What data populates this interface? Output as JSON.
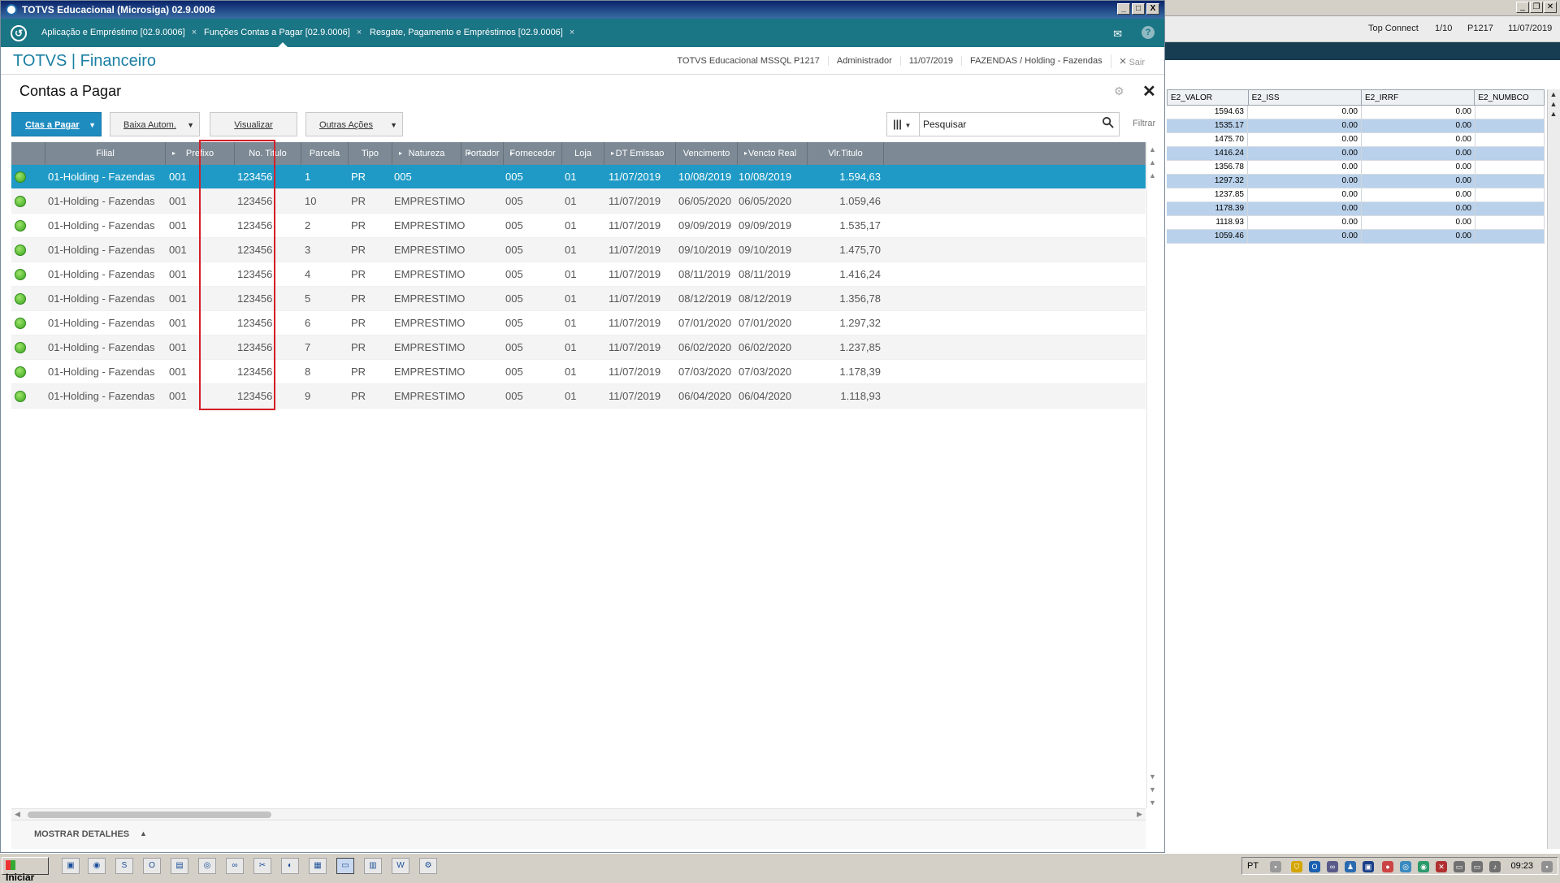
{
  "window": {
    "title": "TOTVS Educacional (Microsiga) 02.9.0006",
    "min_btn": "_",
    "max_btn": "□",
    "close_btn": "X"
  },
  "tabs": [
    {
      "label": "Aplicação e Empréstimo [02.9.0006]",
      "close": "×"
    },
    {
      "label": "Funções Contas a Pagar [02.9.0006]",
      "close": "×"
    },
    {
      "label": "Resgate, Pagamento e Empréstimos [02.9.0006]",
      "close": "×"
    }
  ],
  "header": {
    "app_title": "TOTVS | Financeiro",
    "environment": "TOTVS Educacional MSSQL P1217",
    "user": "Administrador",
    "date": "11/07/2019",
    "company": "FAZENDAS / Holding - Fazendas",
    "exit_icon": "×",
    "exit_label": "Sair"
  },
  "page": {
    "title": "Contas a Pagar",
    "gear_icon": "⚙",
    "close_icon": "✕"
  },
  "toolbar": {
    "ctas_label": "Ctas a Pagar",
    "baixa_label": "Baixa Autom.",
    "visualizar_label": "Visualizar",
    "outras_label": "Outras Ações",
    "search_placeholder": "Pesquisar",
    "search_value": "Pesquisar",
    "filter_label": "Filtrar",
    "caret": "▼",
    "columns_icon": "|||",
    "search_icon": "🔍"
  },
  "grid": {
    "columns": [
      "",
      "Filial",
      "Prefixo",
      "No. Titulo",
      "Parcela",
      "Tipo",
      "Natureza",
      "Portador",
      "Fornecedor",
      "Loja",
      "DT Emissao",
      "Vencimento",
      "Vencto Real",
      "Vlr.Titulo"
    ],
    "sort_marker": "▸",
    "rows": [
      {
        "filial": "01-Holding - Fazendas",
        "prefixo": "001",
        "titulo": "123456",
        "parcela": "1",
        "tipo": "PR",
        "natureza": "005",
        "portador": "",
        "fornecedor": "005",
        "loja": "01",
        "emissao": "11/07/2019",
        "vencimento": "10/08/2019",
        "vencto_real": "10/08/2019",
        "valor": "1.594,63"
      },
      {
        "filial": "01-Holding - Fazendas",
        "prefixo": "001",
        "titulo": "123456",
        "parcela": "10",
        "tipo": "PR",
        "natureza": "EMPRESTIMO",
        "portador": "",
        "fornecedor": "005",
        "loja": "01",
        "emissao": "11/07/2019",
        "vencimento": "06/05/2020",
        "vencto_real": "06/05/2020",
        "valor": "1.059,46"
      },
      {
        "filial": "01-Holding - Fazendas",
        "prefixo": "001",
        "titulo": "123456",
        "parcela": "2",
        "tipo": "PR",
        "natureza": "EMPRESTIMO",
        "portador": "",
        "fornecedor": "005",
        "loja": "01",
        "emissao": "11/07/2019",
        "vencimento": "09/09/2019",
        "vencto_real": "09/09/2019",
        "valor": "1.535,17"
      },
      {
        "filial": "01-Holding - Fazendas",
        "prefixo": "001",
        "titulo": "123456",
        "parcela": "3",
        "tipo": "PR",
        "natureza": "EMPRESTIMO",
        "portador": "",
        "fornecedor": "005",
        "loja": "01",
        "emissao": "11/07/2019",
        "vencimento": "09/10/2019",
        "vencto_real": "09/10/2019",
        "valor": "1.475,70"
      },
      {
        "filial": "01-Holding - Fazendas",
        "prefixo": "001",
        "titulo": "123456",
        "parcela": "4",
        "tipo": "PR",
        "natureza": "EMPRESTIMO",
        "portador": "",
        "fornecedor": "005",
        "loja": "01",
        "emissao": "11/07/2019",
        "vencimento": "08/11/2019",
        "vencto_real": "08/11/2019",
        "valor": "1.416,24"
      },
      {
        "filial": "01-Holding - Fazendas",
        "prefixo": "001",
        "titulo": "123456",
        "parcela": "5",
        "tipo": "PR",
        "natureza": "EMPRESTIMO",
        "portador": "",
        "fornecedor": "005",
        "loja": "01",
        "emissao": "11/07/2019",
        "vencimento": "08/12/2019",
        "vencto_real": "08/12/2019",
        "valor": "1.356,78"
      },
      {
        "filial": "01-Holding - Fazendas",
        "prefixo": "001",
        "titulo": "123456",
        "parcela": "6",
        "tipo": "PR",
        "natureza": "EMPRESTIMO",
        "portador": "",
        "fornecedor": "005",
        "loja": "01",
        "emissao": "11/07/2019",
        "vencimento": "07/01/2020",
        "vencto_real": "07/01/2020",
        "valor": "1.297,32"
      },
      {
        "filial": "01-Holding - Fazendas",
        "prefixo": "001",
        "titulo": "123456",
        "parcela": "7",
        "tipo": "PR",
        "natureza": "EMPRESTIMO",
        "portador": "",
        "fornecedor": "005",
        "loja": "01",
        "emissao": "11/07/2019",
        "vencimento": "06/02/2020",
        "vencto_real": "06/02/2020",
        "valor": "1.237,85"
      },
      {
        "filial": "01-Holding - Fazendas",
        "prefixo": "001",
        "titulo": "123456",
        "parcela": "8",
        "tipo": "PR",
        "natureza": "EMPRESTIMO",
        "portador": "",
        "fornecedor": "005",
        "loja": "01",
        "emissao": "11/07/2019",
        "vencimento": "07/03/2020",
        "vencto_real": "07/03/2020",
        "valor": "1.178,39"
      },
      {
        "filial": "01-Holding - Fazendas",
        "prefixo": "001",
        "titulo": "123456",
        "parcela": "9",
        "tipo": "PR",
        "natureza": "EMPRESTIMO",
        "portador": "",
        "fornecedor": "005",
        "loja": "01",
        "emissao": "11/07/2019",
        "vencimento": "06/04/2020",
        "vencto_real": "06/04/2020",
        "valor": "1.118,93"
      }
    ],
    "selected_row": 0,
    "status_color": "#3aa520",
    "selected_color": "#1f9ac6",
    "highlight_color": "#d31f2a"
  },
  "details": {
    "label": "MOSTRAR DETALHES",
    "arrow": "▲"
  },
  "background_app": {
    "status": {
      "connection": "Top Connect",
      "page": "1/10",
      "env": "P1217",
      "date": "11/07/2019"
    },
    "columns": [
      "E2_VALOR",
      "E2_ISS",
      "E2_IRRF",
      "E2_NUMBCO"
    ],
    "rows": [
      [
        "1594.63",
        "0.00",
        "0.00",
        ""
      ],
      [
        "1535.17",
        "0.00",
        "0.00",
        ""
      ],
      [
        "1475.70",
        "0.00",
        "0.00",
        ""
      ],
      [
        "1416.24",
        "0.00",
        "0.00",
        ""
      ],
      [
        "1356.78",
        "0.00",
        "0.00",
        ""
      ],
      [
        "1297.32",
        "0.00",
        "0.00",
        ""
      ],
      [
        "1237.85",
        "0.00",
        "0.00",
        ""
      ],
      [
        "1178.39",
        "0.00",
        "0.00",
        ""
      ],
      [
        "1118.93",
        "0.00",
        "0.00",
        ""
      ],
      [
        "1059.46",
        "0.00",
        "0.00",
        ""
      ]
    ]
  },
  "taskbar": {
    "start_label": "Iniciar",
    "language": "PT",
    "clock": "09:23"
  }
}
